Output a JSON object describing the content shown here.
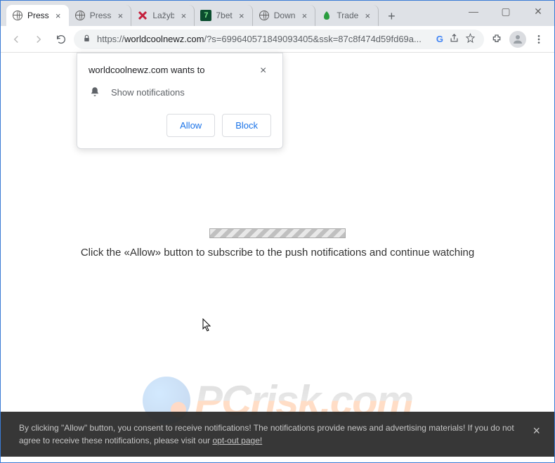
{
  "window": {
    "controls": {
      "minimize": "—",
      "maximize": "▢",
      "close": "✕"
    }
  },
  "tabs": {
    "items": [
      {
        "title": "Press",
        "active": true,
        "favicon": "globe"
      },
      {
        "title": "Press",
        "active": false,
        "favicon": "globe"
      },
      {
        "title": "Lažyb",
        "active": false,
        "favicon": "x-red"
      },
      {
        "title": "7bet",
        "active": false,
        "favicon": "7-green"
      },
      {
        "title": "Down",
        "active": false,
        "favicon": "globe"
      },
      {
        "title": "Trade",
        "active": false,
        "favicon": "leaf-green"
      }
    ],
    "new_tab_label": "+"
  },
  "toolbar": {
    "url_scheme": "https://",
    "url_host": "worldcoolnewz.com",
    "url_path": "/?s=699640571849093405&ssk=87c8f474d59fd69a...",
    "search_provider_icon": "G"
  },
  "permission_prompt": {
    "title": "worldcoolnewz.com wants to",
    "request_text": "Show notifications",
    "allow_label": "Allow",
    "block_label": "Block"
  },
  "page": {
    "message": "Click the «Allow» button to subscribe to the push notifications and continue watching"
  },
  "consent": {
    "text_a": "By clicking \"Allow\" button, you consent to receive notifications! The notifications provide news and advertising materials! If you do not agree to receive these notifications, please visit our ",
    "link_text": "opt-out page!"
  },
  "watermark": {
    "text": "PCrisk.com"
  },
  "colors": {
    "accent": "#1a73e8",
    "frame": "#3a7bd5"
  }
}
